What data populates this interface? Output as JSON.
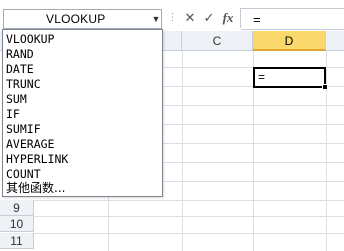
{
  "formula_bar": {
    "name_box": "VLOOKUP",
    "cancel_glyph": "✕",
    "enter_glyph": "✓",
    "fx_label": "fx",
    "formula": "="
  },
  "columns": [
    "C",
    "D"
  ],
  "active_column": "D",
  "rows": [
    "9",
    "10",
    "11"
  ],
  "active_cell": {
    "value": "="
  },
  "function_dropdown": {
    "items": [
      "VLOOKUP",
      "RAND",
      "DATE",
      "TRUNC",
      "SUM",
      "IF",
      "SUMIF",
      "AVERAGE",
      "HYPERLINK",
      "COUNT",
      "其他函数..."
    ]
  },
  "colors": {
    "header_bg": "#eef1f6",
    "active_header_bg": "#fbd86b",
    "gridline": "#dadfe6"
  }
}
